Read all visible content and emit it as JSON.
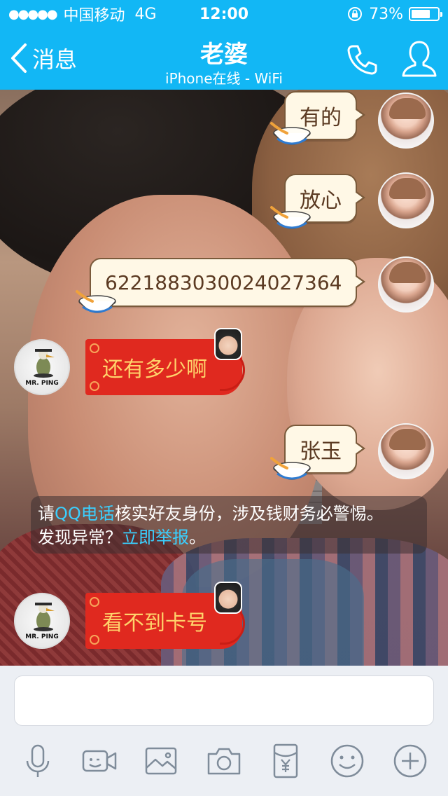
{
  "status_bar": {
    "signal": "●●●●●",
    "carrier": "中国移动",
    "network": "4G",
    "time": "12:00",
    "battery_text": "73%",
    "battery_level": 0.73
  },
  "nav": {
    "back_label": "消息",
    "title": "老婆",
    "subtitle": "iPhone在线 - WiFi"
  },
  "messages": [
    {
      "side": "right",
      "type": "text",
      "text": "有的"
    },
    {
      "side": "right",
      "type": "text",
      "text": "放心"
    },
    {
      "side": "right",
      "type": "text",
      "text": "6221883030024027364"
    },
    {
      "side": "left",
      "type": "text",
      "text": "还有多少啊"
    },
    {
      "side": "right",
      "type": "text",
      "text": "张玉"
    },
    {
      "side": "left",
      "type": "text",
      "text": "看不到卡号"
    }
  ],
  "contacts": {
    "left_avatar_tag": "MR. PING"
  },
  "notice": {
    "part1": "请",
    "link1": "QQ电话",
    "part2": "核实好友身份，涉及钱财务必警惕。",
    "part3": "发现异常？",
    "link2": "立即举报",
    "part4": "。"
  },
  "input": {
    "value": "",
    "placeholder": ""
  },
  "toolbar": [
    "mic-icon",
    "video-icon",
    "image-icon",
    "camera-icon",
    "red-packet-icon",
    "emoji-icon",
    "plus-icon"
  ],
  "colors": {
    "header": "#12b7f5",
    "bubble_out": "#fff8e6",
    "bubble_red": "#e0291f",
    "link": "#3ad0ff"
  }
}
